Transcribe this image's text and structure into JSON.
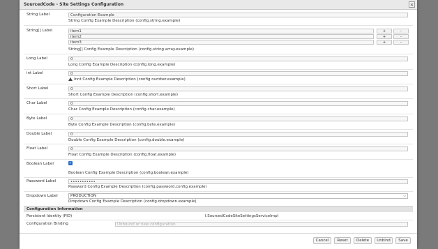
{
  "dialog": {
    "title": "SourcedCode - Site Settings Configuration",
    "close_glyph": "×"
  },
  "fields": {
    "string": {
      "label": "String Label",
      "value": "Configuration Example",
      "desc": "String Config Example Description (config.string.example)"
    },
    "string_array": {
      "label": "String[] Label",
      "items": [
        "item1",
        "item2",
        "item3"
      ],
      "add": "+",
      "remove": "-",
      "desc": "String[] Config Example Description (config.string.array.example)"
    },
    "long": {
      "label": "Long Label",
      "value": "0",
      "desc": "Long Config Example Description (config.long.example)"
    },
    "int": {
      "label": "int Label",
      "value": "0",
      "desc": "innt Config Example Description (config.number.example)"
    },
    "short": {
      "label": "Short Label",
      "value": "0",
      "desc": "Short Config Example Description (config.short.example)"
    },
    "char": {
      "label": "Char Label",
      "value": "0",
      "desc": "Char Config Example Description (config.char.example)"
    },
    "byte": {
      "label": "Byte Label",
      "value": "0",
      "desc": "Byte Config Example Description (config.byte.example)"
    },
    "double": {
      "label": "Double Label",
      "value": "0",
      "desc": "Double Config Example Description (config.double.example)"
    },
    "float": {
      "label": "Float Label",
      "value": "0",
      "desc": "Float Config Example Description (config.float.example)"
    },
    "boolean": {
      "label": "Boolean Label",
      "checked": true,
      "desc": "Boolean Config Example Description (config.boolean.example)"
    },
    "password": {
      "label": "Password Label",
      "value": "•••••••••••",
      "desc": "Password Config Example Description (config.password.config.example)"
    },
    "dropdown": {
      "label": "Dropdown Label",
      "value": "PRODUCTION",
      "desc": "Dropdown Config Example Description (config.dropdown.example)"
    }
  },
  "info": {
    "heading": "Configuration Information",
    "pid_label": "Persistent Identity (PID)",
    "pid_value": "l.SourcedCodeSiteSettingsServiceImpl",
    "binding_label": "Configuration Binding",
    "binding_placeholder": "Unbound or new configuration"
  },
  "footer": {
    "cancel": "Cancel",
    "reset": "Reset",
    "delete": "Delete",
    "unbind": "Unbind",
    "save": "Save"
  },
  "colors": {
    "accent": "#2d6ec8",
    "backdrop": "#7a7a7a"
  }
}
